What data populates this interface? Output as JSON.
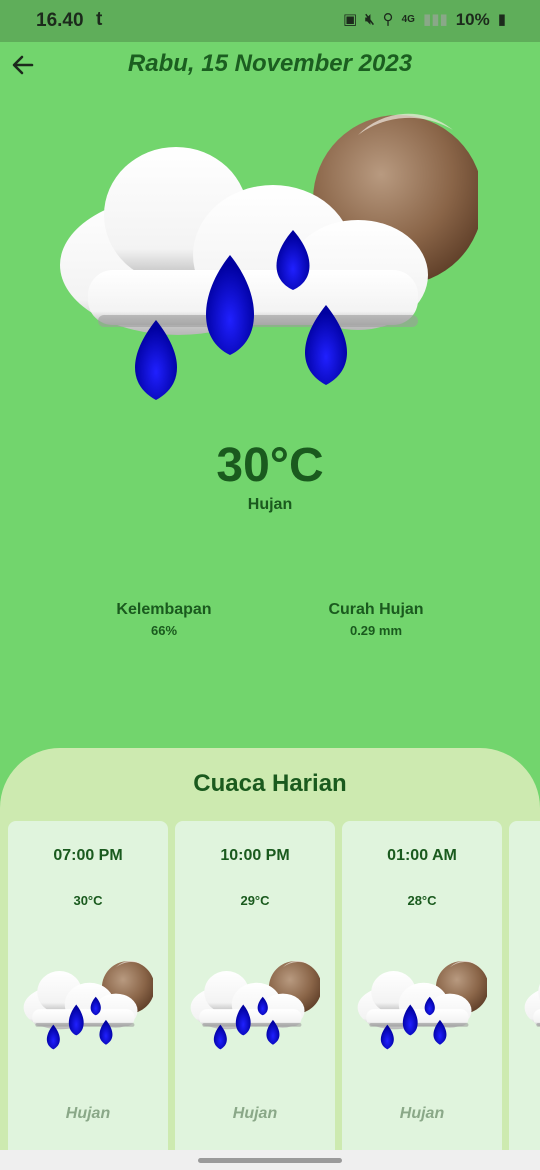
{
  "status_bar": {
    "time": "16.40",
    "app_glyph": "t",
    "network": "4G",
    "battery": "10%"
  },
  "header": {
    "date": "Rabu, 15 November 2023"
  },
  "current": {
    "temperature": "30°C",
    "condition": "Hujan",
    "humidity_label": "Kelembapan",
    "humidity_value": "66%",
    "rainfall_label": "Curah Hujan",
    "rainfall_value": "0.29 mm",
    "icon": "rain-cloud-moon-icon"
  },
  "daily": {
    "title": "Cuaca Harian",
    "items": [
      {
        "time": "07:00 PM",
        "temp": "30°C",
        "condition": "Hujan"
      },
      {
        "time": "10:00 PM",
        "temp": "29°C",
        "condition": "Hujan"
      },
      {
        "time": "01:00 AM",
        "temp": "28°C",
        "condition": "Hujan"
      }
    ]
  },
  "colors": {
    "background": "#72d56d",
    "panel": "#cdeab0",
    "card": "#e0f4dd",
    "text": "#1b5e20"
  }
}
